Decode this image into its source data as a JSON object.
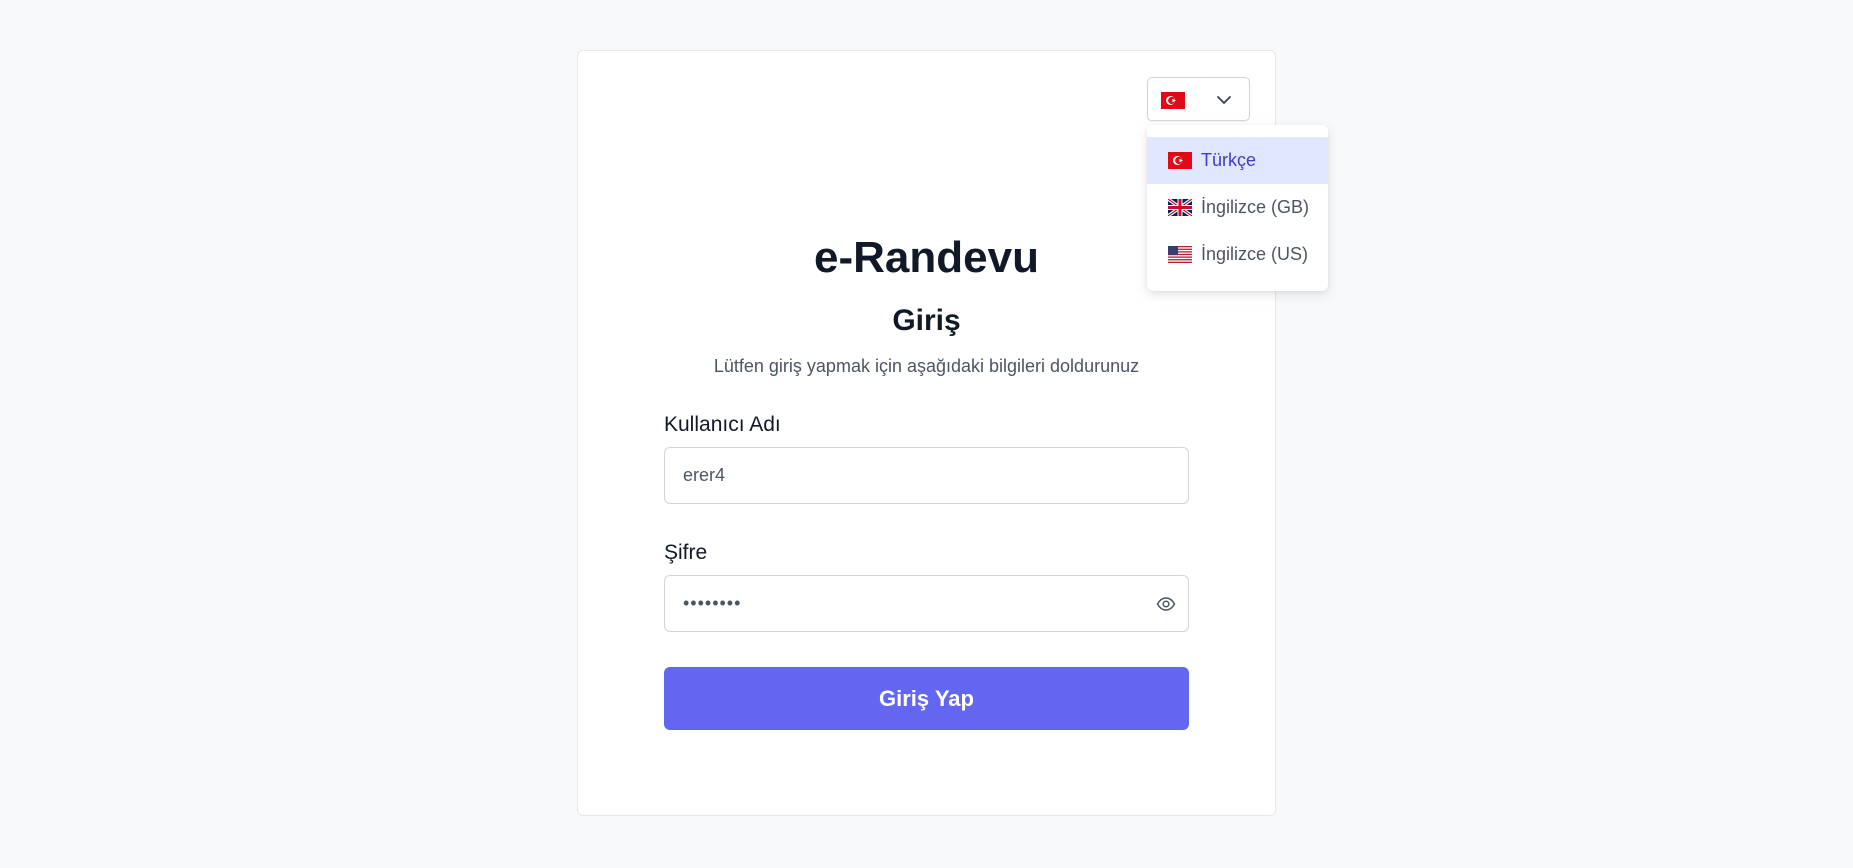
{
  "app": {
    "title": "e-Randevu",
    "subtitle": "Giriş",
    "hint": "Lütfen giriş yapmak için aşağıdaki bilgileri doldurunuz"
  },
  "language": {
    "current_flag": "turkey-flag-icon",
    "options": [
      {
        "label": "Türkçe",
        "icon": "turkey-flag-icon",
        "selected": true
      },
      {
        "label": "İngilizce (GB)",
        "icon": "uk-flag-icon",
        "selected": false
      },
      {
        "label": "İngilizce (US)",
        "icon": "us-flag-icon",
        "selected": false
      }
    ]
  },
  "form": {
    "username_label": "Kullanıcı Adı",
    "username_value": "erer4",
    "password_label": "Şifre",
    "password_value": "••••••••",
    "password_toggle_icon": "eye-icon",
    "submit_label": "Giriş Yap"
  },
  "colors": {
    "accent": "#6366f1",
    "selected_bg": "#e0e7ff",
    "selected_text": "#4338ca",
    "page_bg": "#f8f9fb"
  }
}
